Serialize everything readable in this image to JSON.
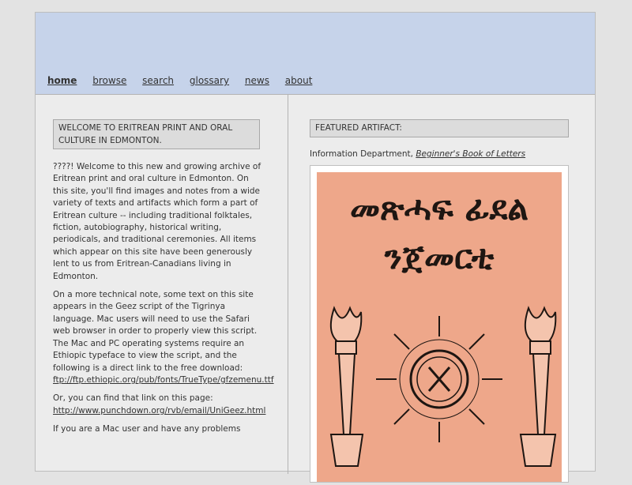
{
  "nav": {
    "home": "home",
    "browse": "browse",
    "search": "search",
    "glossary": "glossary",
    "news": "news",
    "about": "about"
  },
  "left": {
    "heading": "WELCOME TO ERITREAN PRINT AND ORAL CULTURE IN EDMONTON.",
    "p1": "????! Welcome to this new and growing archive of Eritrean print and oral culture in Edmonton. On this site, you'll find images and notes from a wide variety of texts and artifacts which form a part of Eritrean culture -- including traditional folktales, fiction, autobiography, historical writing, periodicals, and traditional ceremonies. All items which appear on this site have been generously lent to us from Eritrean-Canadians living in Edmonton.",
    "p2": "On a more technical note, some text on this site appears in the Geez script of the Tigrinya language. Mac users will need to use the Safari web browser in order to properly view this script. The Mac and PC operating systems require an Ethiopic typeface to view the script, and the following is a direct link to the free download:",
    "link1": "ftp://ftp.ethiopic.org/pub/fonts/TrueType/gfzemenu.ttf",
    "p3": "Or, you can find that link on this page:",
    "link2": "http://www.punchdown.org/rvb/email/UniGeez.html",
    "p4": "If you are a Mac user and have any problems"
  },
  "right": {
    "heading": "FEATURED ARTIFACT:",
    "credit_prefix": "Information Department,",
    "credit_title": "Beginner's Book of Letters",
    "cover": {
      "title_line1": "መጽሓፍ ፊደል",
      "title_line2": "ንጀመርቲ"
    }
  },
  "colors": {
    "header_bg": "#c6d3ea",
    "page_bg": "#e3e3e3",
    "box_bg": "#dcdcdc",
    "cover_bg": "#eea78a",
    "cover_ink": "#1e1612"
  }
}
